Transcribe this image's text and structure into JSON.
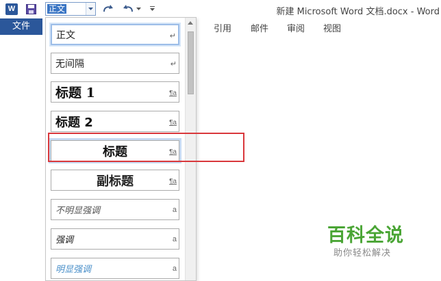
{
  "app": {
    "window_title": "新建 Microsoft Word 文档.docx - Word",
    "brand_color": "#2b579a",
    "logo_letter": "W"
  },
  "qat": {
    "style_combo_value": "正文",
    "icons": [
      "word-logo-icon",
      "save-icon",
      "redo-icon",
      "undo-icon",
      "dropdown-icon",
      "customize-icon"
    ]
  },
  "ribbon": {
    "file_tab": "文件",
    "tabs": [
      "引用",
      "邮件",
      "审阅",
      "视图"
    ]
  },
  "gallery": {
    "items": [
      {
        "label": "正文",
        "mark": "↵"
      },
      {
        "label": "无间隔",
        "mark": "↵"
      },
      {
        "label": "标题 1",
        "mark": "¶a"
      },
      {
        "label": "标题 2",
        "mark": "¶a"
      },
      {
        "label": "标题",
        "mark": "¶a"
      },
      {
        "label": "副标题",
        "mark": "¶a"
      },
      {
        "label": "不明显强调",
        "mark": "a"
      },
      {
        "label": "强调",
        "mark": "a"
      },
      {
        "label": "明显强调",
        "mark": "a"
      }
    ],
    "highlight_color": "#d9373b"
  },
  "watermark": {
    "title": "百科全说",
    "subtitle": "助你轻松解决",
    "color": "#4aa535"
  }
}
